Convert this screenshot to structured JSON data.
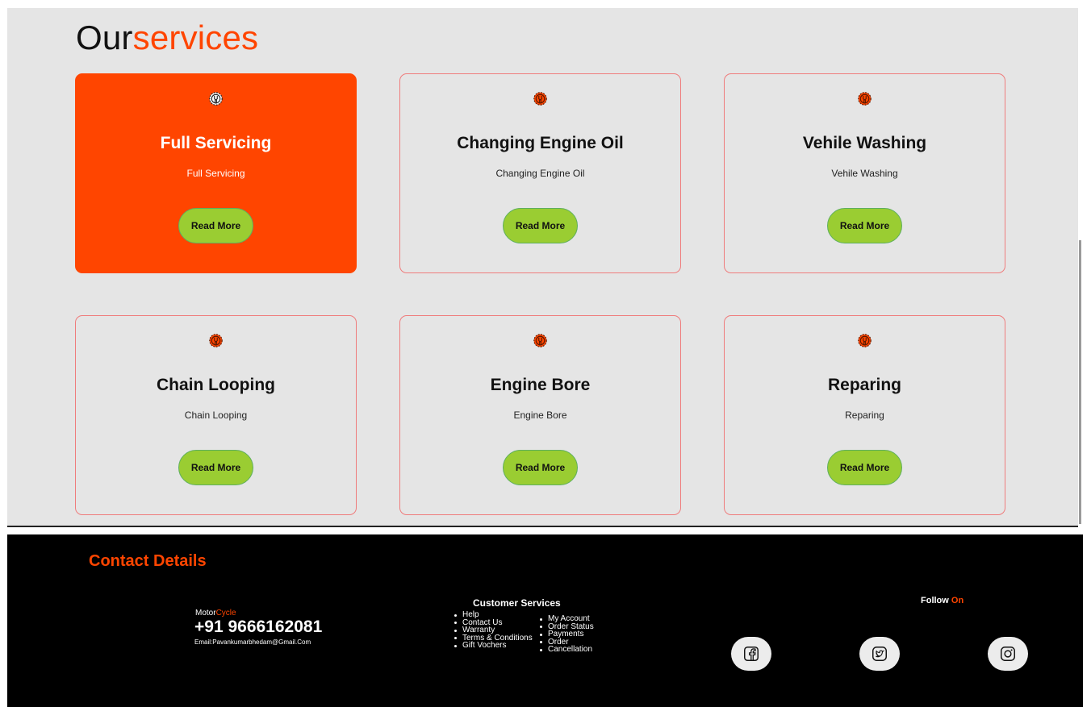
{
  "services": {
    "title_part1": "Our",
    "title_part2": "services",
    "cards": [
      {
        "title": "Full Servicing",
        "description": "Full Servicing",
        "button": "Read More",
        "icon": "gear-wrench-icon",
        "active": true
      },
      {
        "title": "Changing Engine Oil",
        "description": "Changing Engine Oil",
        "button": "Read More",
        "icon": "gear-wrench-icon",
        "active": false
      },
      {
        "title": "Vehile Washing",
        "description": "Vehile Washing",
        "button": "Read More",
        "icon": "gear-wrench-icon",
        "active": false
      },
      {
        "title": "Chain Looping",
        "description": "Chain Looping",
        "button": "Read More",
        "icon": "gear-wrench-icon",
        "active": false
      },
      {
        "title": "Engine Bore",
        "description": "Engine Bore",
        "button": "Read More",
        "icon": "gear-wrench-icon",
        "active": false
      },
      {
        "title": "Reparing",
        "description": "Reparing",
        "button": "Read More",
        "icon": "gear-wrench-icon",
        "active": false
      }
    ]
  },
  "footer": {
    "contact_title": "Contact Details",
    "brand_part1": "Motor",
    "brand_part2": "Cycle",
    "phone": "+91 9666162081",
    "email": "Email:Pavankumarbhedam@Gmail.Com",
    "customer_services": {
      "title": "Customer Services",
      "left": [
        "Help",
        "Contact Us",
        "Warranty",
        "Terms & Conditions",
        "Gift Vochers"
      ],
      "right": [
        "My Account",
        "Order Status",
        "Payments",
        "Order",
        "Cancellation"
      ]
    },
    "follow_part1": "Follow",
    "follow_part2": "On",
    "social": [
      {
        "name": "facebook-icon"
      },
      {
        "name": "twitter-icon"
      },
      {
        "name": "instagram-icon"
      }
    ]
  },
  "colors": {
    "accent": "#ff4500",
    "button": "#9acd32",
    "section_bg": "#e5e5e5",
    "footer_bg": "#000000"
  }
}
